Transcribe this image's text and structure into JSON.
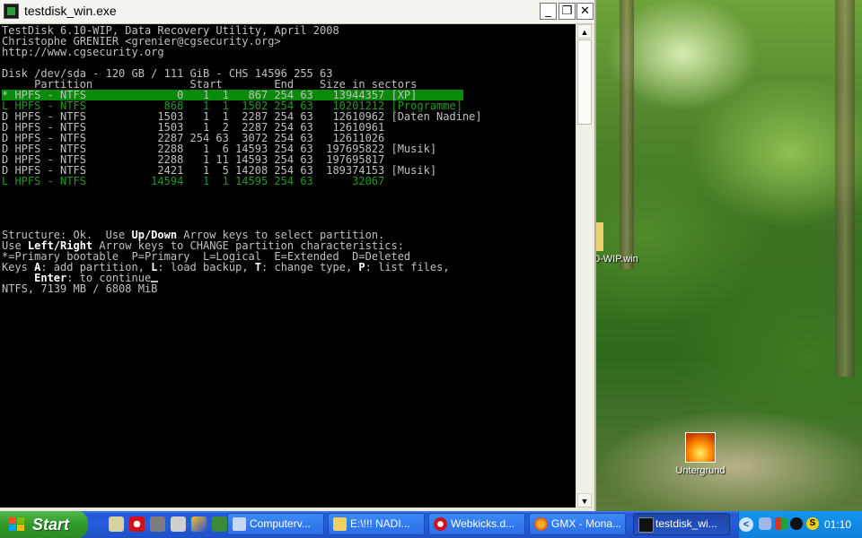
{
  "window": {
    "title": "testdisk_win.exe"
  },
  "console": {
    "lines": [
      "TestDisk 6.10-WIP, Data Recovery Utility, April 2008",
      "Christophe GRENIER <grenier@cgsecurity.org>",
      "http://www.cgsecurity.org",
      "",
      "Disk /dev/sda - 120 GB / 111 GiB - CHS 14596 255 63",
      "     Partition               Start        End    Size in sectors"
    ],
    "partitions": [
      "* HPFS - NTFS              0   1  1   867 254 63   13944357 [XP]",
      "L HPFS - NTFS            868   1  1  1502 254 63   10201212 [Programme]",
      "D HPFS - NTFS           1503   1  1  2287 254 63   12610962 [Daten Nadine]",
      "D HPFS - NTFS           1503   1  2  2287 254 63   12610961",
      "D HPFS - NTFS           2287 254 63  3072 254 63   12611026",
      "D HPFS - NTFS           2288   1  6 14593 254 63  197695822 [Musik]",
      "D HPFS - NTFS           2288   1 11 14593 254 63  197695817",
      "D HPFS - NTFS           2421   1  5 14208 254 63  189374153 [Musik]",
      "L HPFS - NTFS          14594   1  1 14595 254 63      32067"
    ],
    "help": {
      "l1a": "Structure: Ok.  Use ",
      "l1b": "Up/Down",
      "l1c": " Arrow keys to select partition.",
      "l2a": "Use ",
      "l2b": "Left/Right",
      "l2c": " Arrow keys to CHANGE partition characteristics:",
      "l3": "*=Primary bootable  P=Primary  L=Logical  E=Extended  D=Deleted",
      "l4a": "Keys ",
      "l4b": "A",
      "l4c": ": add partition, ",
      "l4d": "L",
      "l4e": ": load backup, ",
      "l4f": "T",
      "l4g": ": change type, ",
      "l4h": "P",
      "l4i": ": list files,",
      "l5a": "     ",
      "l5b": "Enter",
      "l5c": ": to continue",
      "l6": "NTFS, 7139 MB / 6808 MiB"
    }
  },
  "desktop": {
    "icons": [
      {
        "label": "0-WIP.win"
      },
      {
        "label": "Untergrund"
      }
    ]
  },
  "taskbar": {
    "start_label": "Start",
    "tasks": [
      {
        "label": "Computerv..."
      },
      {
        "label": "E:\\!!! NADI..."
      },
      {
        "label": "Webkicks.d..."
      },
      {
        "label": "GMX - Mona..."
      },
      {
        "label": "testdisk_wi..."
      }
    ],
    "clock": "01:10"
  },
  "colors": {
    "highlight": "#0a8a0a",
    "logical": "#1f9a1f",
    "taskbar": "#245edb",
    "start": "#2f9a2a"
  }
}
